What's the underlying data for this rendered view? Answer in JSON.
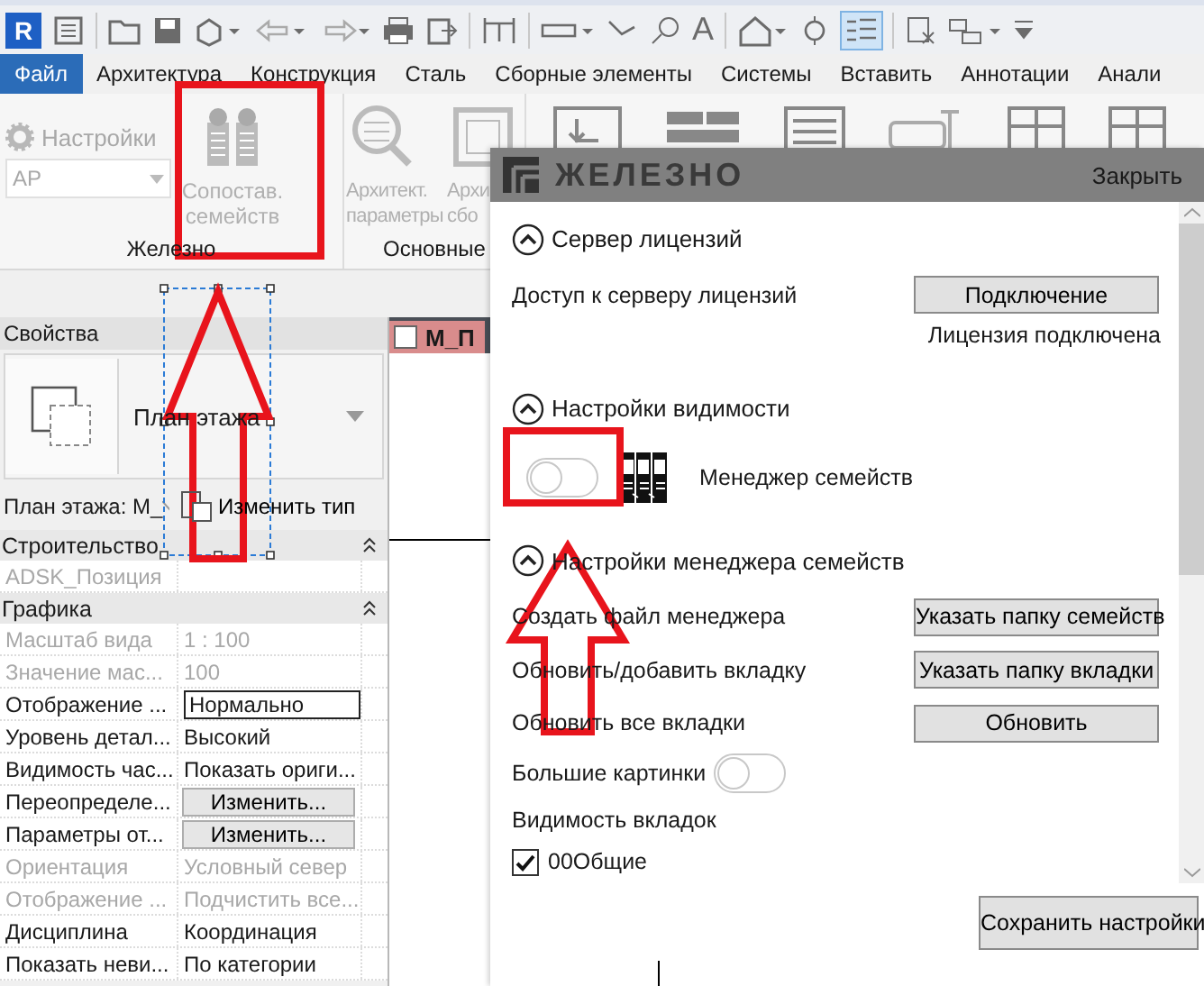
{
  "app": {
    "logo": "R",
    "text_tool": "A"
  },
  "ribbon_tabs": [
    {
      "label": "Файл",
      "kind": "file"
    },
    {
      "label": "Архитектура",
      "kind": "tab"
    },
    {
      "label": "Конструкция",
      "kind": "tab"
    },
    {
      "label": "Сталь",
      "kind": "tab"
    },
    {
      "label": "Сборные элементы",
      "kind": "tab"
    },
    {
      "label": "Системы",
      "kind": "tab"
    },
    {
      "label": "Вставить",
      "kind": "tab"
    },
    {
      "label": "Аннотации",
      "kind": "tab"
    },
    {
      "label": "Анали",
      "kind": "tab"
    }
  ],
  "ribbon": {
    "settings": {
      "label": "Настройки",
      "disabled": true
    },
    "system_dropdown": {
      "value": "АР"
    },
    "buttons": [
      {
        "lines": [
          "Сопостав.",
          "семейств"
        ],
        "disabled": true,
        "kind": "match"
      },
      {
        "lines": [
          "Архитект.",
          "параметры"
        ],
        "disabled": true,
        "kind": "search"
      },
      {
        "lines": [
          "Архи",
          "сбо"
        ],
        "disabled": true,
        "kind": "frame"
      }
    ],
    "panel_titles": [
      "Железно",
      "Основные"
    ]
  },
  "properties": {
    "title": "Свойства",
    "type_name": "План этажа",
    "view_selector": "План этажа: M_",
    "edit_type": "Изменить тип",
    "groups": [
      {
        "name": "Строительство",
        "expanded": true,
        "rows": [
          {
            "name": "ADSK_Позиция",
            "kind": "text",
            "disabled": true
          }
        ]
      },
      {
        "name": "Графика",
        "expanded": true,
        "rows": [
          {
            "name": "Масштаб вида",
            "value": "1 : 100",
            "kind": "text",
            "disabled": true
          },
          {
            "name": "Значение мас...",
            "value": "100",
            "kind": "text",
            "disabled": true
          },
          {
            "name": "Отображение ...",
            "value": "Нормально",
            "kind": "field",
            "disabled": false
          },
          {
            "name": "Уровень детал...",
            "value": "Высокий",
            "kind": "text",
            "disabled": false
          },
          {
            "name": "Видимость час...",
            "value": "Показать ориги...",
            "kind": "text",
            "disabled": false
          },
          {
            "name": "Переопределе...",
            "value": "Изменить...",
            "kind": "button",
            "disabled": false
          },
          {
            "name": "Параметры от...",
            "value": "Изменить...",
            "kind": "button",
            "disabled": false
          },
          {
            "name": "Ориентация",
            "value": "Условный север",
            "kind": "text",
            "disabled": true
          },
          {
            "name": "Отображение ...",
            "value": "Подчистить все...",
            "kind": "text",
            "disabled": true
          },
          {
            "name": "Дисциплина",
            "value": "Координация",
            "kind": "text",
            "disabled": false
          },
          {
            "name": "Показать неви...",
            "value": "По категории",
            "kind": "text",
            "disabled": false
          }
        ]
      }
    ]
  },
  "view": {
    "tab_label": "M_П"
  },
  "dialog": {
    "brand": "ЖЕЛЕЗНО",
    "close": "Закрыть",
    "sections": [
      {
        "title": "Сервер лицензий",
        "expanded": true,
        "items": [
          {
            "kind": "button_row",
            "label": "Доступ к серверу лицензий",
            "button": "Подключение"
          },
          {
            "kind": "status",
            "text": "Лицензия подключена"
          }
        ]
      },
      {
        "title": "Настройки видимости",
        "expanded": true,
        "items": [
          {
            "kind": "toggle_icon",
            "label": "Менеджер семейств",
            "on": false
          }
        ]
      },
      {
        "title": "Настройки менеджера семейств",
        "expanded": true,
        "items": [
          {
            "kind": "button_row",
            "label": "Создать файл менеджера",
            "button": "Указать папку семейств"
          },
          {
            "kind": "button_row",
            "label": "Обновить/добавить вкладку",
            "button": "Указать папку вкладки"
          },
          {
            "kind": "button_row",
            "label": "Обновить все вкладки",
            "button": "Обновить"
          },
          {
            "kind": "toggle",
            "label": "Большие картинки",
            "on": false
          },
          {
            "kind": "heading",
            "text": "Видимость вкладок"
          },
          {
            "kind": "checkbox",
            "label": "00Общие",
            "checked": true
          }
        ]
      }
    ],
    "save_button": "Сохранить настройки"
  }
}
